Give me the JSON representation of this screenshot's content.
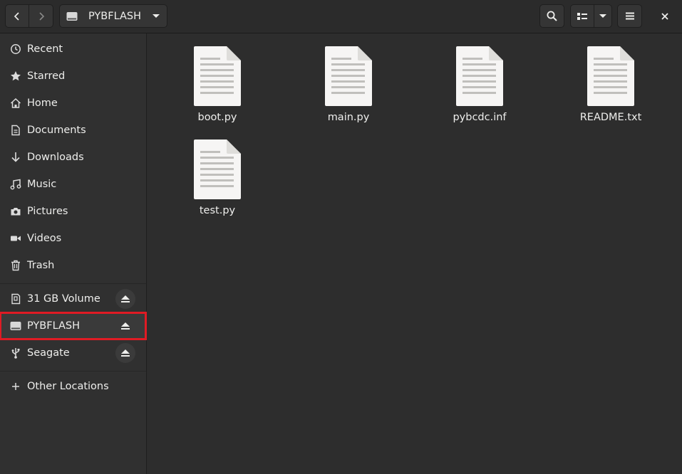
{
  "header": {
    "location": "PYBFLASH",
    "icons": {
      "back": "go-previous-icon",
      "forward": "go-next-icon",
      "drive": "drive-removable-icon",
      "dropdown": "pan-down-icon",
      "search": "search-icon",
      "view_list": "view-list-icon",
      "view_menu": "pan-down-icon",
      "menu": "hamburger-menu-icon",
      "close": "close-icon"
    }
  },
  "sidebar": {
    "places": [
      {
        "label": "Recent",
        "icon": "clock-icon"
      },
      {
        "label": "Starred",
        "icon": "star-icon"
      },
      {
        "label": "Home",
        "icon": "home-icon"
      },
      {
        "label": "Documents",
        "icon": "document-icon"
      },
      {
        "label": "Downloads",
        "icon": "download-icon"
      },
      {
        "label": "Music",
        "icon": "music-icon"
      },
      {
        "label": "Pictures",
        "icon": "camera-icon"
      },
      {
        "label": "Videos",
        "icon": "video-icon"
      },
      {
        "label": "Trash",
        "icon": "trash-icon"
      }
    ],
    "devices": [
      {
        "label": "31 GB Volume",
        "icon": "sd-card-icon",
        "eject": true
      },
      {
        "label": "PYBFLASH",
        "icon": "drive-removable-icon",
        "eject": true,
        "selected": true
      },
      {
        "label": "Seagate",
        "icon": "usb-icon",
        "eject": true
      }
    ],
    "other": {
      "label": "Other Locations",
      "icon": "plus-icon"
    }
  },
  "files": [
    {
      "name": "boot.py",
      "icon": "text-file-icon"
    },
    {
      "name": "main.py",
      "icon": "text-file-icon"
    },
    {
      "name": "pybcdc.inf",
      "icon": "text-file-icon"
    },
    {
      "name": "README.txt",
      "icon": "text-file-icon"
    },
    {
      "name": "test.py",
      "icon": "text-file-icon"
    }
  ],
  "colors": {
    "background": "#2d2d2d",
    "sidebar": "#303030",
    "highlight_outline": "#e01b24",
    "text": "#eeeeec"
  }
}
